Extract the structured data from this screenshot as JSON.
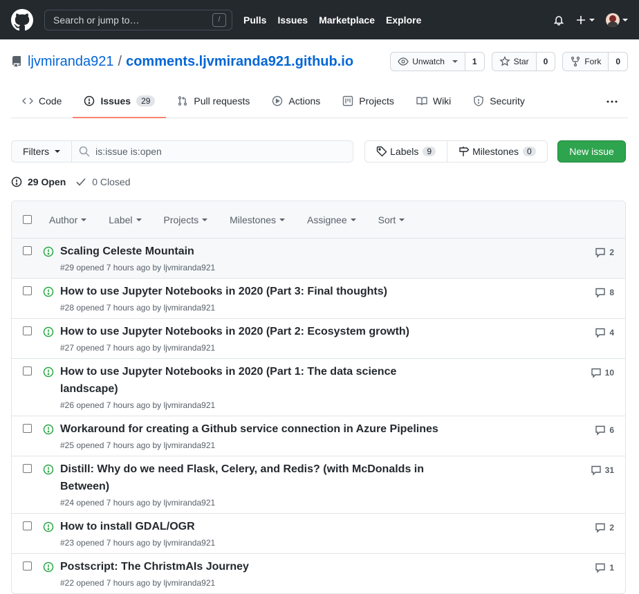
{
  "header": {
    "search_placeholder": "Search or jump to…",
    "slash_key": "/",
    "nav": [
      "Pulls",
      "Issues",
      "Marketplace",
      "Explore"
    ]
  },
  "repo": {
    "owner": "ljvmiranda921",
    "separator": "/",
    "name": "comments.ljvmiranda921.github.io",
    "watch_label": "Unwatch",
    "watch_count": "1",
    "star_label": "Star",
    "star_count": "0",
    "fork_label": "Fork",
    "fork_count": "0"
  },
  "tabs": {
    "code": "Code",
    "issues": "Issues",
    "issues_count": "29",
    "pulls": "Pull requests",
    "actions": "Actions",
    "projects": "Projects",
    "wiki": "Wiki",
    "security": "Security"
  },
  "subnav": {
    "filters_label": "Filters",
    "filter_query": "is:issue is:open",
    "labels_label": "Labels",
    "labels_count": "9",
    "milestones_label": "Milestones",
    "milestones_count": "0",
    "new_issue_label": "New issue"
  },
  "states": {
    "open_label": "29 Open",
    "closed_label": "0 Closed"
  },
  "list_header": {
    "author": "Author",
    "label": "Label",
    "projects": "Projects",
    "milestones": "Milestones",
    "assignee": "Assignee",
    "sort": "Sort"
  },
  "issues": [
    {
      "title": "Scaling Celeste Mountain",
      "meta": "#29 opened 7 hours ago by ljvmiranda921",
      "comments": "2"
    },
    {
      "title": "How to use Jupyter Notebooks in 2020 (Part 3: Final thoughts)",
      "meta": "#28 opened 7 hours ago by ljvmiranda921",
      "comments": "8"
    },
    {
      "title": "How to use Jupyter Notebooks in 2020 (Part 2: Ecosystem growth)",
      "meta": "#27 opened 7 hours ago by ljvmiranda921",
      "comments": "4"
    },
    {
      "title": "How to use Jupyter Notebooks in 2020 (Part 1: The data science landscape)",
      "meta": "#26 opened 7 hours ago by ljvmiranda921",
      "comments": "10"
    },
    {
      "title": "Workaround for creating a Github service connection in Azure Pipelines",
      "meta": "#25 opened 7 hours ago by ljvmiranda921",
      "comments": "6"
    },
    {
      "title": "Distill: Why do we need Flask, Celery, and Redis? (with McDonalds in Between)",
      "meta": "#24 opened 7 hours ago by ljvmiranda921",
      "comments": "31"
    },
    {
      "title": "How to install GDAL/OGR",
      "meta": "#23 opened 7 hours ago by ljvmiranda921",
      "comments": "2"
    },
    {
      "title": "Postscript: The ChristmAIs Journey",
      "meta": "#22 opened 7 hours ago by ljvmiranda921",
      "comments": "1"
    }
  ]
}
